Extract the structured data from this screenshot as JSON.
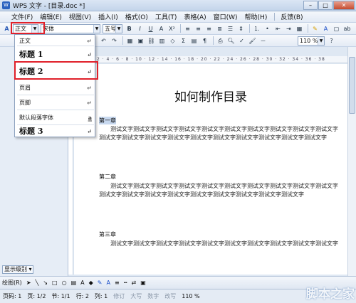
{
  "window": {
    "title": "WPS 文字 - [目录.doc *]",
    "logo": "W"
  },
  "menu": [
    "文件(F)",
    "编辑(E)",
    "视图(V)",
    "插入(I)",
    "格式(O)",
    "工具(T)",
    "表格(A)",
    "窗口(W)",
    "帮助(H)",
    "反馈(B)"
  ],
  "toolbar": {
    "style_value": "正文",
    "font_value": "宋体",
    "size_value": "五号",
    "bold": "B",
    "italic": "I",
    "underline": "U",
    "zoom": "110 %"
  },
  "ruler": "2 · 4 · 6 · 8 · 10 · 12 · 14 · 16 · 18 · 20 · 22 · 24 · 26 · 28 · 30 · 32 · 34 · 36 · 38",
  "style_dropdown": {
    "items": [
      {
        "label": "正文",
        "kind": "body"
      },
      {
        "label": "标题 1",
        "kind": "heading"
      },
      {
        "label": "标题 2",
        "kind": "heading"
      },
      {
        "label": "页眉",
        "kind": "body"
      },
      {
        "label": "页脚",
        "kind": "body"
      },
      {
        "label": "默认段落字体",
        "kind": "body",
        "suffix": "a"
      },
      {
        "label": "标题 3",
        "kind": "heading"
      }
    ],
    "return_glyph": "↵"
  },
  "document": {
    "title": "如何制作目录",
    "chapters": [
      {
        "heading": "第一章",
        "text": "测试文字测试文字测试文字测试文字测试文字测试文字测试文字测试文字测试文字测试文字测试文字测试文字测试文字测试文字测试文字测试文字测试文字测试文字测试文字测试文字"
      },
      {
        "heading": "第二章",
        "text": "测试文字测试文字测试文字测试文字测试文字测试文字测试文字测试文字测试文字测试文字测试文字测试文字测试文字测试文字测试文字测试文字测试文字测试文字测试文字"
      },
      {
        "heading": "第三章",
        "text": "测试文字测试文字测试文字测试文字测试文字测试文字测试文字测试文字测试文字测试文字"
      }
    ]
  },
  "show_level": "显示级别",
  "drawing_label": "绘图(R)",
  "status": {
    "page": "页码: 1",
    "pages": "页: 1/2",
    "section": "节: 1/1",
    "row": "行: 2",
    "col": "列: 1",
    "rev": "修订",
    "caps": "大写",
    "num": "数字",
    "ovr": "改写",
    "zoom": "110 %"
  },
  "watermark": "脚本之家"
}
